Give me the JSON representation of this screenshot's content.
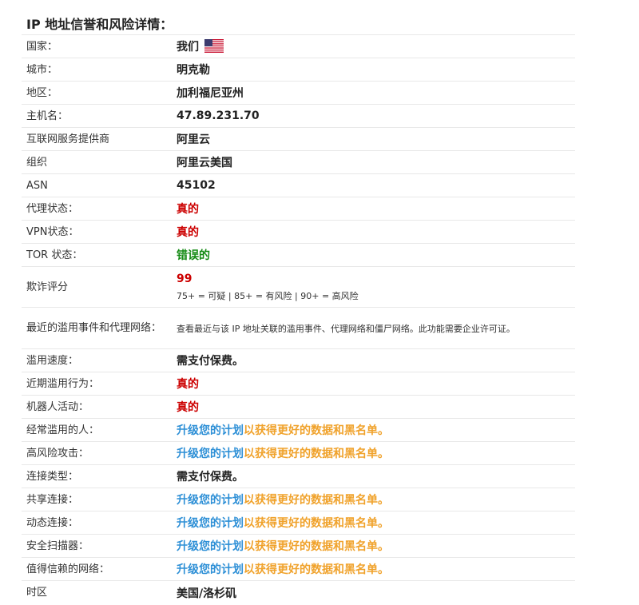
{
  "heading": "IP 地址信誉和风险详情：",
  "rows": {
    "country": {
      "label": "国家：",
      "value": "我们"
    },
    "city": {
      "label": "城市：",
      "value": "明克勒"
    },
    "region": {
      "label": "地区：",
      "value": "加利福尼亚州"
    },
    "hostname": {
      "label": "主机名：",
      "value": "47.89.231.70"
    },
    "isp": {
      "label": "互联网服务提供商",
      "value": "阿里云"
    },
    "org": {
      "label": "组织",
      "value": "阿里云美国"
    },
    "asn": {
      "label": "ASN",
      "value": "45102"
    },
    "proxy": {
      "label": "代理状态：",
      "value": "真的"
    },
    "vpn": {
      "label": "VPN状态：",
      "value": "真的"
    },
    "tor": {
      "label": "TOR 状态：",
      "value": "错误的"
    },
    "fraud": {
      "label": "欺诈评分",
      "value": "99",
      "note": "75+ = 可疑 | 85+ = 有风险 | 90+ = 高风险"
    },
    "recent_abuse_events": {
      "label": "最近的滥用事件和代理网络：",
      "value": "查看最近与该 IP 地址关联的滥用事件、代理网络和僵尸网络。此功能需要企业许可证。"
    },
    "abuse_velocity": {
      "label": "滥用速度：",
      "value": "需支付保费。"
    },
    "recent_abuse": {
      "label": "近期滥用行为：",
      "value": "真的"
    },
    "bot_activity": {
      "label": "机器人活动：",
      "value": "真的"
    },
    "frequent_abuser": {
      "label": "经常滥用的人：",
      "link": "升级您的计划",
      "rest": "以获得更好的数据和黑名单。"
    },
    "high_risk_attacks": {
      "label": "高风险攻击：",
      "link": "升级您的计划",
      "rest": "以获得更好的数据和黑名单。"
    },
    "connection_type": {
      "label": "连接类型：",
      "value": "需支付保费。"
    },
    "shared_connection": {
      "label": "共享连接：",
      "link": "升级您的计划",
      "rest": "以获得更好的数据和黑名单。"
    },
    "dynamic_connection": {
      "label": "动态连接：",
      "link": "升级您的计划",
      "rest": "以获得更好的数据和黑名单。"
    },
    "security_scanner": {
      "label": "安全扫描器：",
      "link": "升级您的计划",
      "rest": "以获得更好的数据和黑名单。"
    },
    "trusted_network": {
      "label": "值得信赖的网络：",
      "link": "升级您的计划",
      "rest": "以获得更好的数据和黑名单。"
    },
    "timezone": {
      "label": "时区",
      "value": "美国/洛杉矶"
    }
  },
  "colors": {
    "red": "#cc0000",
    "green": "#138a13",
    "link_blue": "#2d8fd6",
    "link_orange": "#f0a22b"
  },
  "icons": {
    "country_flag": "us-flag-icon"
  }
}
